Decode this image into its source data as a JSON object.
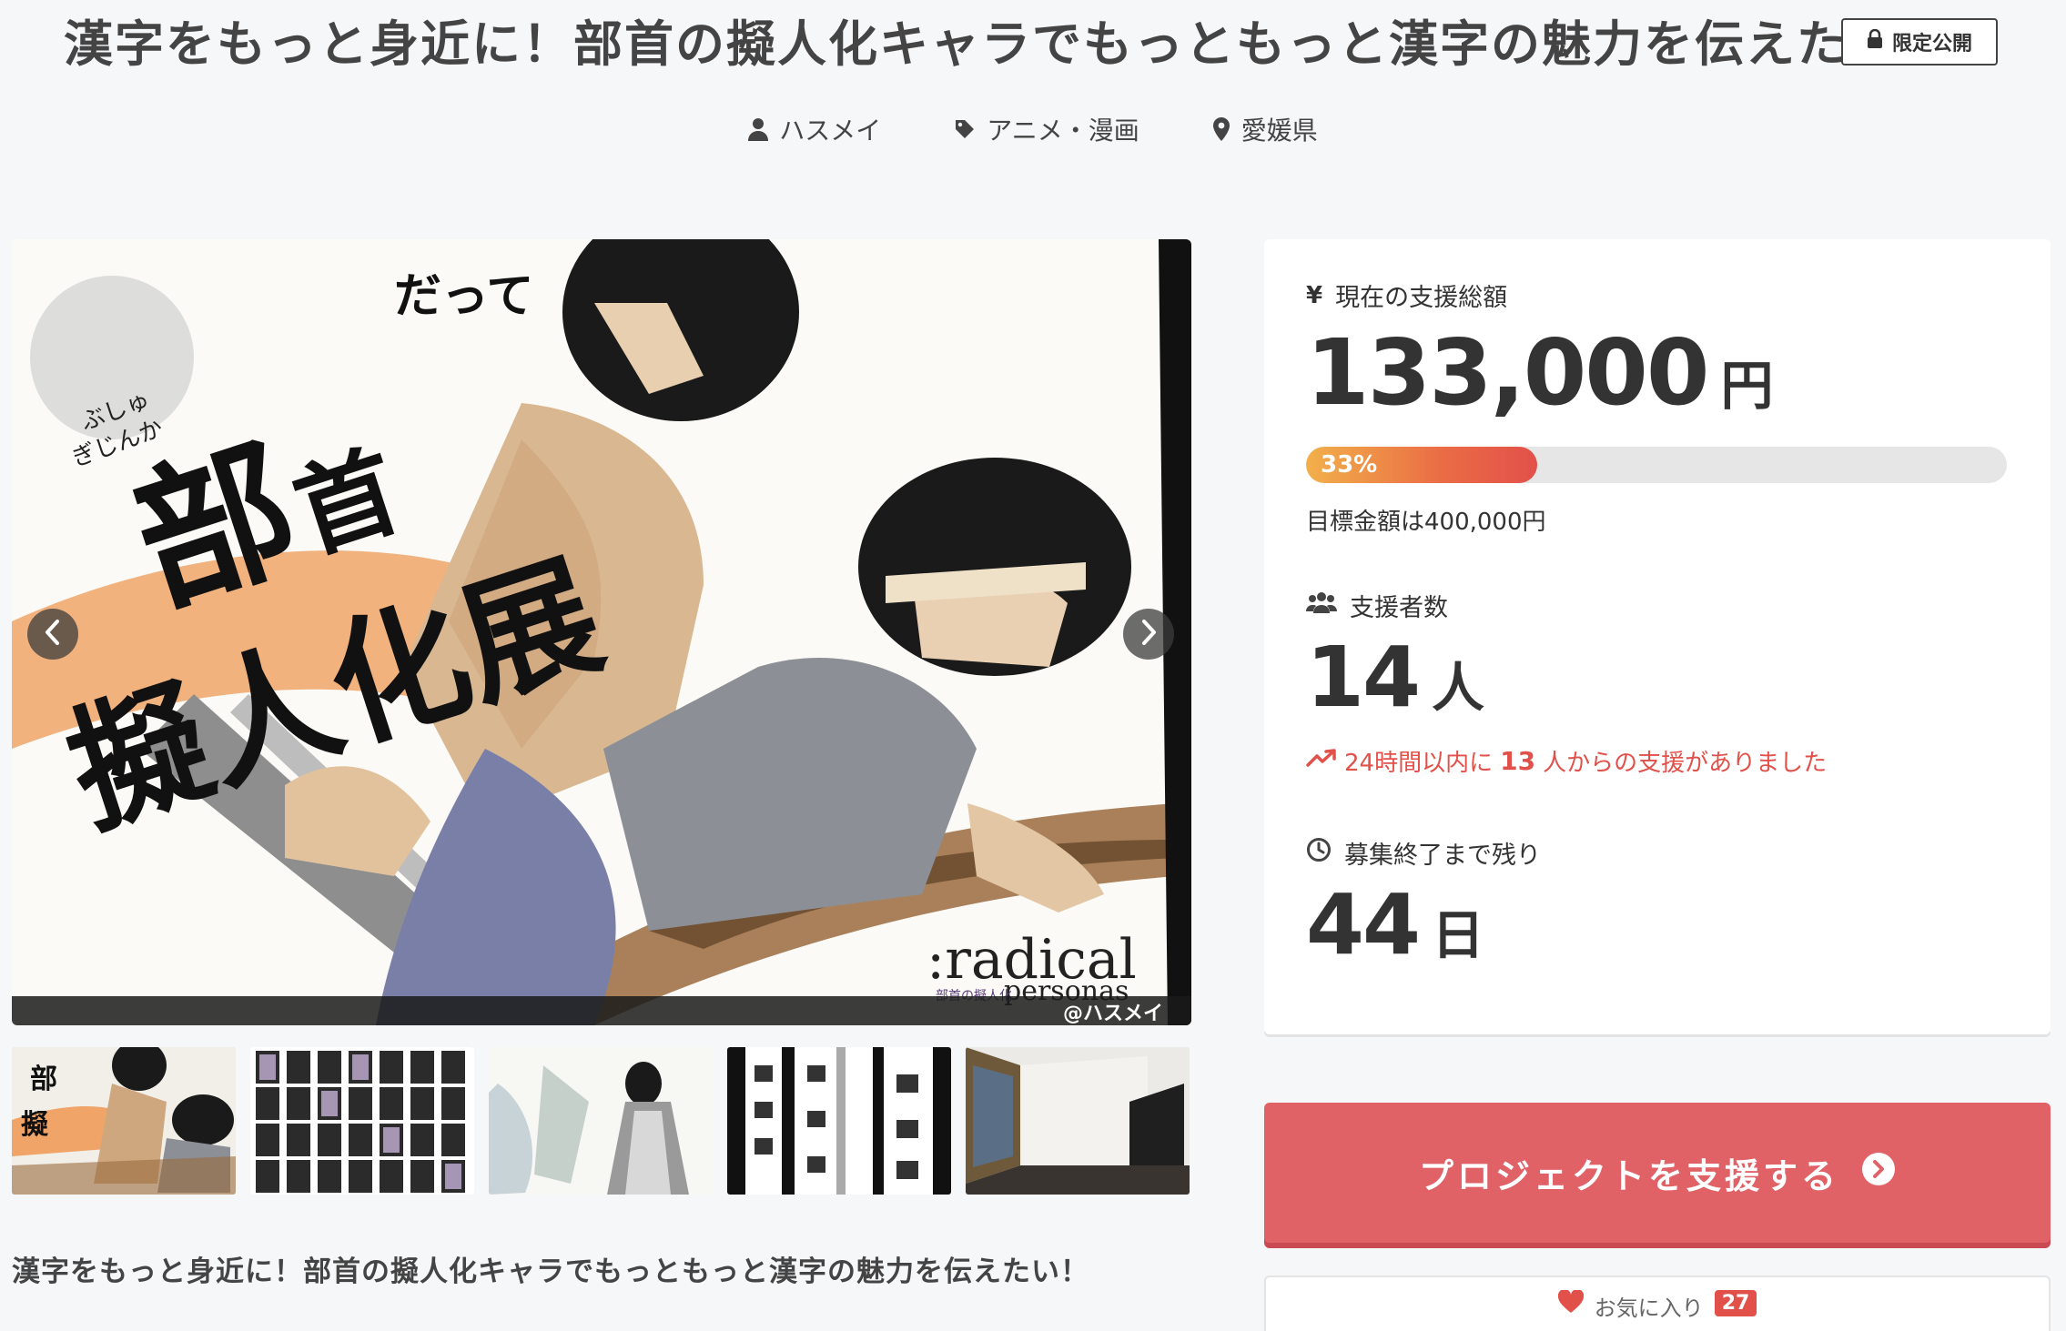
{
  "title": "漢字をもっと身近に！部首の擬人化キャラでもっともっと漢字の魅力を伝えたい！",
  "badge": "限定公開",
  "meta": {
    "author": "ハスメイ",
    "category": "アニメ・漫画",
    "location": "愛媛県"
  },
  "hero": {
    "headline_big1": "部",
    "headline_big2": "首",
    "headline_small": "だって",
    "headline_line2": "擬人化展",
    "ruby1": "ぶしゅ",
    "ruby2": "ぎじんか",
    "logo_main": ":radical",
    "logo_sub": "personas",
    "logo_kanji": "部首の擬人化",
    "credit": "@ハスメイ"
  },
  "stats": {
    "amount_label": "現在の支援総額",
    "amount_value": "133,000",
    "amount_unit": "円",
    "progress_percent": 33,
    "progress_label": "33%",
    "goal_text": "目標金額は400,000円",
    "backers_label": "支援者数",
    "backers_value": "14",
    "backers_unit": "人",
    "trend_prefix": "24時間以内に",
    "trend_number": "13",
    "trend_suffix": "人からの支援がありました",
    "remaining_label": "募集終了まで残り",
    "remaining_value": "44",
    "remaining_unit": "日"
  },
  "support_button": "プロジェクトを支援する",
  "favorite": {
    "label": "お気に入り",
    "count": "27"
  },
  "sub_title": "漢字をもっと身近に！部首の擬人化キャラでもっともっと漢字の魅力を伝えたい！",
  "colors": {
    "accent": "#e06266",
    "progress_start": "#f2b04a",
    "progress_end": "#e2504a",
    "trend": "#e2504a"
  }
}
